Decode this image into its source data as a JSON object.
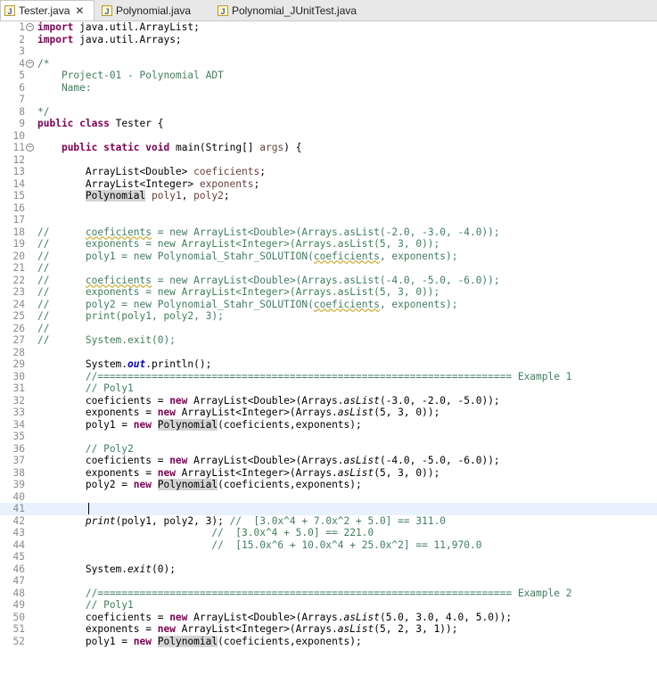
{
  "tabs": [
    {
      "label": "Tester.java",
      "active": true,
      "close": "✕"
    },
    {
      "label": "Polynomial.java",
      "active": false
    },
    {
      "label": "Polynomial_JUnitTest.java",
      "active": false
    }
  ],
  "lines": [
    {
      "n": "1",
      "fold": "−",
      "segs": [
        {
          "t": "import",
          "k": "kw"
        },
        {
          "t": " java.util.ArrayList;"
        }
      ]
    },
    {
      "n": "2",
      "segs": [
        {
          "t": "import",
          "k": "kw"
        },
        {
          "t": " java.util.Arrays;"
        }
      ]
    },
    {
      "n": "3",
      "segs": []
    },
    {
      "n": "4",
      "fold": "−",
      "segs": [
        {
          "t": "/*",
          "k": "cm"
        }
      ]
    },
    {
      "n": "5",
      "segs": [
        {
          "t": "    Project-01 - Polynomial ADT",
          "k": "cm"
        }
      ]
    },
    {
      "n": "6",
      "segs": [
        {
          "t": "    Name:",
          "k": "cm"
        }
      ]
    },
    {
      "n": "7",
      "segs": []
    },
    {
      "n": "8",
      "segs": [
        {
          "t": "*/",
          "k": "cm"
        }
      ]
    },
    {
      "n": "9",
      "segs": [
        {
          "t": "public",
          "k": "kw"
        },
        {
          "t": " "
        },
        {
          "t": "class",
          "k": "kw"
        },
        {
          "t": " Tester {"
        }
      ]
    },
    {
      "n": "10",
      "segs": []
    },
    {
      "n": "11",
      "fold": "−",
      "segs": [
        {
          "t": "    "
        },
        {
          "t": "public",
          "k": "kw"
        },
        {
          "t": " "
        },
        {
          "t": "static",
          "k": "kw"
        },
        {
          "t": " "
        },
        {
          "t": "void",
          "k": "kw"
        },
        {
          "t": " main(String[] "
        },
        {
          "t": "args",
          "k": "param"
        },
        {
          "t": ") {"
        }
      ]
    },
    {
      "n": "12",
      "segs": []
    },
    {
      "n": "13",
      "segs": [
        {
          "t": "        ArrayList<Double> "
        },
        {
          "t": "coeficients",
          "k": "param"
        },
        {
          "t": ";"
        }
      ]
    },
    {
      "n": "14",
      "segs": [
        {
          "t": "        ArrayList<Integer> "
        },
        {
          "t": "exponents",
          "k": "param"
        },
        {
          "t": ";"
        }
      ]
    },
    {
      "n": "15",
      "segs": [
        {
          "t": "        "
        },
        {
          "t": "Polynomial",
          "k": "hl"
        },
        {
          "t": " "
        },
        {
          "t": "poly1",
          "k": "param"
        },
        {
          "t": ", "
        },
        {
          "t": "poly2",
          "k": "param"
        },
        {
          "t": ";"
        }
      ]
    },
    {
      "n": "16",
      "segs": []
    },
    {
      "n": "17",
      "segs": []
    },
    {
      "n": "18",
      "segs": [
        {
          "t": "//      ",
          "k": "cm"
        },
        {
          "t": "coeficients",
          "k": "cm squig"
        },
        {
          "t": " = new ArrayList<Double>(Arrays.asList(-2.0, -3.0, -4.0));",
          "k": "cm"
        }
      ]
    },
    {
      "n": "19",
      "segs": [
        {
          "t": "//      exponents = new ArrayList<Integer>(Arrays.asList(5, 3, 0));",
          "k": "cm"
        }
      ]
    },
    {
      "n": "20",
      "segs": [
        {
          "t": "//      poly1 = new Polynomial_Stahr_SOLUTION(",
          "k": "cm"
        },
        {
          "t": "coeficients",
          "k": "cm squig"
        },
        {
          "t": ", exponents);",
          "k": "cm"
        }
      ]
    },
    {
      "n": "21",
      "segs": [
        {
          "t": "//",
          "k": "cm"
        }
      ]
    },
    {
      "n": "22",
      "segs": [
        {
          "t": "//      ",
          "k": "cm"
        },
        {
          "t": "coeficients",
          "k": "cm squig"
        },
        {
          "t": " = new ArrayList<Double>(Arrays.asList(-4.0, -5.0, -6.0));",
          "k": "cm"
        }
      ]
    },
    {
      "n": "23",
      "segs": [
        {
          "t": "//      exponents = new ArrayList<Integer>(Arrays.asList(5, 3, 0));",
          "k": "cm"
        }
      ]
    },
    {
      "n": "24",
      "segs": [
        {
          "t": "//      poly2 = new Polynomial_Stahr_SOLUTION(",
          "k": "cm"
        },
        {
          "t": "coeficients",
          "k": "cm squig"
        },
        {
          "t": ", exponents);",
          "k": "cm"
        }
      ]
    },
    {
      "n": "25",
      "segs": [
        {
          "t": "//      print(poly1, poly2, 3);",
          "k": "cm"
        }
      ]
    },
    {
      "n": "26",
      "segs": [
        {
          "t": "//",
          "k": "cm"
        }
      ]
    },
    {
      "n": "27",
      "segs": [
        {
          "t": "//      System.exit(0);",
          "k": "cm"
        }
      ]
    },
    {
      "n": "28",
      "segs": []
    },
    {
      "n": "29",
      "segs": [
        {
          "t": "        System."
        },
        {
          "t": "out",
          "k": "fld"
        },
        {
          "t": ".println();"
        }
      ]
    },
    {
      "n": "30",
      "segs": [
        {
          "t": "        //===================================================================== Example 1",
          "k": "cm"
        }
      ]
    },
    {
      "n": "31",
      "segs": [
        {
          "t": "        // Poly1",
          "k": "cm"
        }
      ]
    },
    {
      "n": "32",
      "segs": [
        {
          "t": "        coeficients = "
        },
        {
          "t": "new",
          "k": "kw"
        },
        {
          "t": " ArrayList<Double>(Arrays."
        },
        {
          "t": "asList",
          "k": "it"
        },
        {
          "t": "(-3.0, -2.0, -5.0));"
        }
      ]
    },
    {
      "n": "33",
      "segs": [
        {
          "t": "        exponents = "
        },
        {
          "t": "new",
          "k": "kw"
        },
        {
          "t": " ArrayList<Integer>(Arrays."
        },
        {
          "t": "asList",
          "k": "it"
        },
        {
          "t": "(5, 3, 0));"
        }
      ]
    },
    {
      "n": "34",
      "segs": [
        {
          "t": "        poly1 = "
        },
        {
          "t": "new",
          "k": "kw"
        },
        {
          "t": " "
        },
        {
          "t": "Polynomial",
          "k": "hl"
        },
        {
          "t": "(coeficients,exponents);"
        }
      ]
    },
    {
      "n": "35",
      "segs": []
    },
    {
      "n": "36",
      "segs": [
        {
          "t": "        // Poly2",
          "k": "cm"
        }
      ]
    },
    {
      "n": "37",
      "segs": [
        {
          "t": "        coeficients = "
        },
        {
          "t": "new",
          "k": "kw"
        },
        {
          "t": " ArrayList<Double>(Arrays."
        },
        {
          "t": "asList",
          "k": "it"
        },
        {
          "t": "(-4.0, -5.0, -6.0));"
        }
      ]
    },
    {
      "n": "38",
      "segs": [
        {
          "t": "        exponents = "
        },
        {
          "t": "new",
          "k": "kw"
        },
        {
          "t": " ArrayList<Integer>(Arrays."
        },
        {
          "t": "asList",
          "k": "it"
        },
        {
          "t": "(5, 3, 0));"
        }
      ]
    },
    {
      "n": "39",
      "segs": [
        {
          "t": "        poly2 = "
        },
        {
          "t": "new",
          "k": "kw"
        },
        {
          "t": " "
        },
        {
          "t": "Polynomial",
          "k": "hl"
        },
        {
          "t": "(coeficients,exponents);"
        }
      ]
    },
    {
      "n": "40",
      "segs": []
    },
    {
      "n": "41",
      "caret": true,
      "segs": []
    },
    {
      "n": "42",
      "segs": [
        {
          "t": "        "
        },
        {
          "t": "print",
          "k": "it"
        },
        {
          "t": "(poly1, poly2, 3); "
        },
        {
          "t": "//  [3.0x^4 + 7.0x^2 + 5.0] == 311.0",
          "k": "cm"
        }
      ]
    },
    {
      "n": "43",
      "segs": [
        {
          "t": "                             "
        },
        {
          "t": "//  [3.0x^4 + 5.0] == 221.0",
          "k": "cm"
        }
      ]
    },
    {
      "n": "44",
      "segs": [
        {
          "t": "                             "
        },
        {
          "t": "//  [15.0x^6 + 10.0x^4 + 25.0x^2] == 11,970.0",
          "k": "cm"
        }
      ]
    },
    {
      "n": "45",
      "segs": []
    },
    {
      "n": "46",
      "segs": [
        {
          "t": "        System."
        },
        {
          "t": "exit",
          "k": "it"
        },
        {
          "t": "(0);"
        }
      ]
    },
    {
      "n": "47",
      "segs": []
    },
    {
      "n": "48",
      "segs": [
        {
          "t": "        //===================================================================== Example 2",
          "k": "cm"
        }
      ]
    },
    {
      "n": "49",
      "segs": [
        {
          "t": "        // Poly1",
          "k": "cm"
        }
      ]
    },
    {
      "n": "50",
      "segs": [
        {
          "t": "        coeficients = "
        },
        {
          "t": "new",
          "k": "kw"
        },
        {
          "t": " ArrayList<Double>(Arrays."
        },
        {
          "t": "asList",
          "k": "it"
        },
        {
          "t": "(5.0, 3.0, 4.0, 5.0));"
        }
      ]
    },
    {
      "n": "51",
      "segs": [
        {
          "t": "        exponents = "
        },
        {
          "t": "new",
          "k": "kw"
        },
        {
          "t": " ArrayList<Integer>(Arrays."
        },
        {
          "t": "asList",
          "k": "it"
        },
        {
          "t": "(5, 2, 3, 1));"
        }
      ]
    },
    {
      "n": "52",
      "segs": [
        {
          "t": "        poly1 = "
        },
        {
          "t": "new",
          "k": "kw"
        },
        {
          "t": " "
        },
        {
          "t": "Polynomial",
          "k": "hl"
        },
        {
          "t": "(coeficients,exponents);"
        }
      ]
    }
  ]
}
